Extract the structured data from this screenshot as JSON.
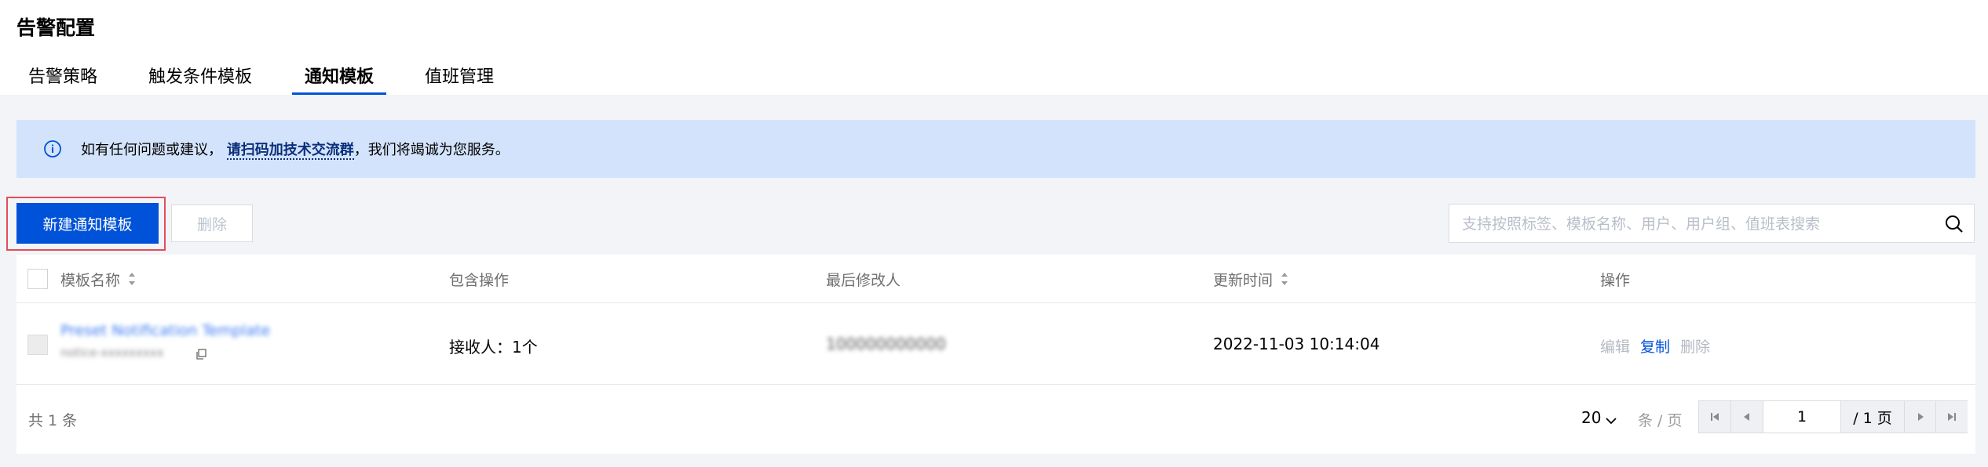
{
  "page": {
    "title": "告警配置"
  },
  "tabs": [
    {
      "label": "告警策略"
    },
    {
      "label": "触发条件模板"
    },
    {
      "label": "通知模板"
    },
    {
      "label": "值班管理"
    }
  ],
  "notice": {
    "prefix": "如有任何问题或建议，",
    "link": "请扫码加技术交流群",
    "suffix": "，我们将竭诚为您服务。"
  },
  "toolbar": {
    "new_label": "新建通知模板",
    "delete_label": "删除",
    "search_placeholder": "支持按照标签、模板名称、用户、用户组、值班表搜索"
  },
  "table": {
    "columns": [
      "模板名称",
      "包含操作",
      "最后修改人",
      "更新时间",
      "操作"
    ],
    "rows": [
      {
        "name": "Preset Notification Template",
        "id": "notice-xxxxxxxxx",
        "includes": "接收人：1个",
        "modifier": "100000000000",
        "updated": "2022-11-03 10:14:04",
        "actions": [
          "编辑",
          "复制",
          "删除"
        ]
      }
    ]
  },
  "footer": {
    "total": "共 1 条",
    "page_size": "20",
    "per_page": "条 / 页",
    "current_page": "1",
    "total_pages": "/ 1 页"
  },
  "colors": {
    "primary": "#0052d9",
    "notice_bg": "#d4e3fc",
    "highlight": "#e34d59"
  }
}
